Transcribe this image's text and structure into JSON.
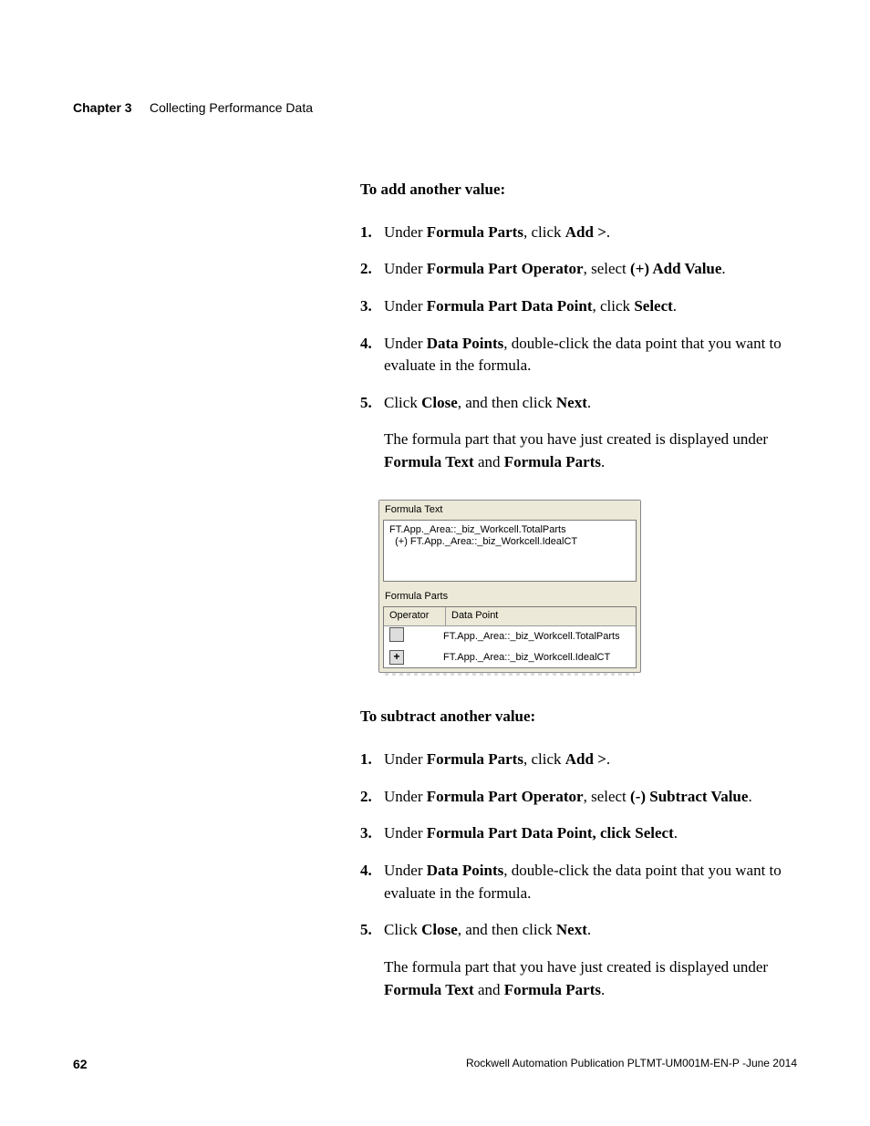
{
  "header": {
    "chapter": "Chapter 3",
    "title": "Collecting Performance Data"
  },
  "sections": {
    "add": {
      "title": "To add another value:",
      "operator_label": "(+) Add Value"
    },
    "subtract": {
      "title": "To subtract another value:",
      "operator_label": "(-) Subtract Value"
    },
    "common": {
      "step1_pre": "Under ",
      "step1_b": "Formula Parts",
      "step1_mid": ", click ",
      "step1_b2": "Add >",
      "step1_end": ".",
      "step2_pre": "Under ",
      "step2_b": "Formula Part Operator",
      "step2_mid": ", select ",
      "step2_end": ".",
      "step3_pre": "Under ",
      "step3_b": "Formula Part Data Point",
      "step3_mid": ", click ",
      "step3_b2": "Select",
      "step3_end": ".",
      "step4_pre": "Under ",
      "step4_b": "Data Points",
      "step4_rest": ", double-click the data point that you want to evaluate in the formula.",
      "step5_pre": "Click ",
      "step5_b1": "Close",
      "step5_mid": ", and then click ",
      "step5_b2": "Next",
      "step5_end": ".",
      "follow_pre": "The formula part that you have just created is displayed under ",
      "follow_b1": "Formula Text",
      "follow_mid": " and ",
      "follow_b2": "Formula Parts",
      "follow_end": "."
    }
  },
  "screenshot": {
    "formula_text_label": "Formula Text",
    "formula_text_content": "FT.App._Area::_biz_Workcell.TotalParts\n  (+) FT.App._Area::_biz_Workcell.IdealCT",
    "formula_parts_label": "Formula Parts",
    "col_operator": "Operator",
    "col_datapoint": "Data Point",
    "rows": [
      {
        "op": "",
        "dp": "FT.App._Area::_biz_Workcell.TotalParts"
      },
      {
        "op": "+",
        "dp": "FT.App._Area::_biz_Workcell.IdealCT"
      }
    ]
  },
  "footer": {
    "page": "62",
    "pub": "Rockwell Automation Publication PLTMT-UM001M-EN-P -June 2014"
  }
}
